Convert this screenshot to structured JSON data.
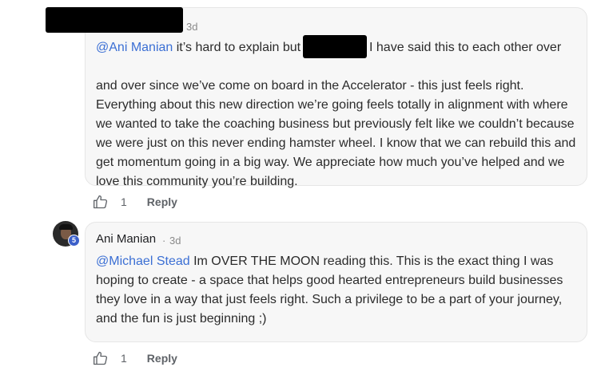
{
  "comments": [
    {
      "author": "",
      "time": "3d",
      "mention": "@Ani Manian",
      "lines": [
        " it’s hard to explain but",
        "I have said this to each other over",
        "and over since we’ve come on board in the Accelerator - this just feels right.",
        "Everything about this new direction we’re going feels totally in alignment with where",
        "we wanted to take the coaching business but previously felt like we couldn’t because",
        "we were just on this never ending hamster wheel. I know that we can rebuild this and",
        "get momentum going in a big way. We appreciate how much you’ve helped and we",
        "love this community you’re building."
      ],
      "like_count": "1",
      "reply_label": "Reply"
    },
    {
      "author": "Ani Manian",
      "level_badge": "5",
      "separator": "·",
      "time": "3d",
      "mention": "@Michael Stead",
      "lines": [
        " Im OVER THE MOON reading this. This is the exact thing I was",
        "hoping to create - a space that helps good hearted entrepreneurs build businesses",
        "they love in a way that just feels right. Such a privilege to be a part of your journey,",
        "and the fun is just beginning ;)"
      ],
      "like_count": "1",
      "reply_label": "Reply"
    }
  ],
  "icons": {
    "like": "thumbs-up-icon"
  },
  "colors": {
    "mention": "#3b6fd4",
    "badge": "#3b5fc9",
    "bubble": "#f7f7f7"
  }
}
